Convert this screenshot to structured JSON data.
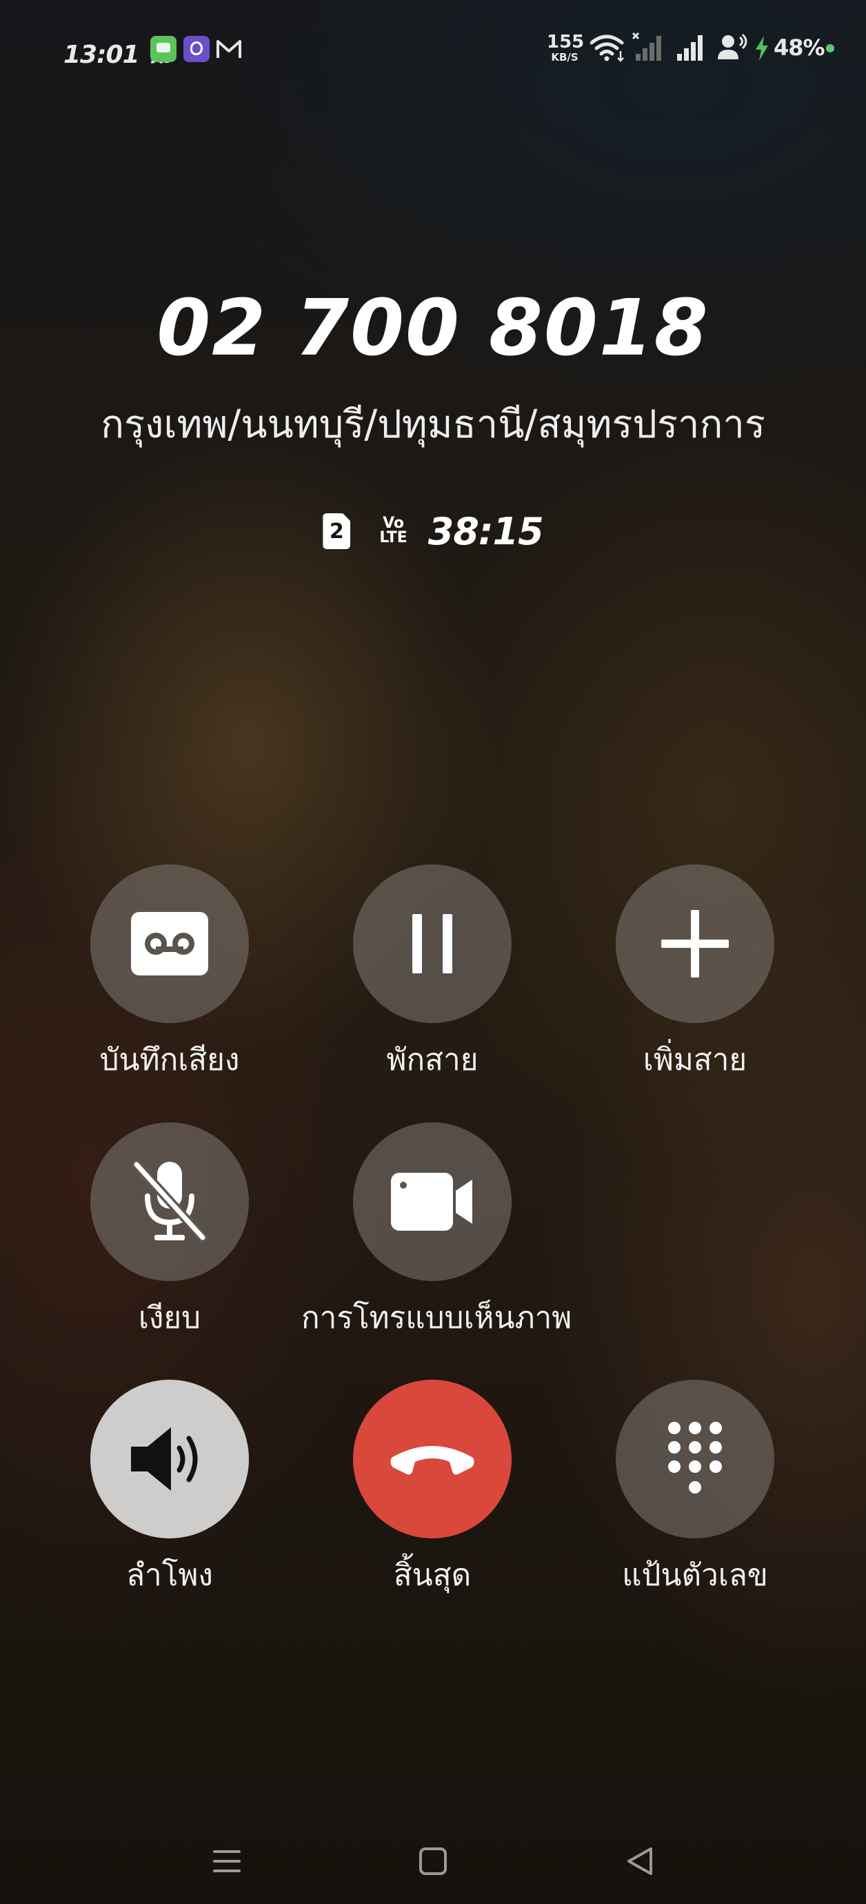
{
  "status_bar": {
    "time": "13:01 น.",
    "net_speed_value": "155",
    "net_speed_unit": "KB/S",
    "battery": "48%",
    "icons": [
      "messages-app-icon",
      "viber-app-icon",
      "gmail-icon",
      "wifi-icon",
      "signal-sim1-icon",
      "signal-sim2-icon",
      "hotspot-icon",
      "charging-icon"
    ]
  },
  "call": {
    "number": "02 700 8018",
    "location": "กรุงเทพ/นนทบุรี/ปทุมธานี/สมุทรปราการ",
    "sim": "2",
    "volte_top": "Vo",
    "volte_bottom": "LTE",
    "duration": "38:15"
  },
  "controls": {
    "record": "บันทึกเสียง",
    "hold": "พักสาย",
    "add_call": "เพิ่มสาย",
    "mute": "เงียบ",
    "video_call": "การโทรแบบเห็นภาพ",
    "speaker": "ลำโพง",
    "end_call": "สิ้นสุด",
    "keypad": "แป้นตัวเลข"
  },
  "colors": {
    "end_call": "#d9483b",
    "speaker_active": "#cfcdcb",
    "button_default": "#76706a"
  }
}
